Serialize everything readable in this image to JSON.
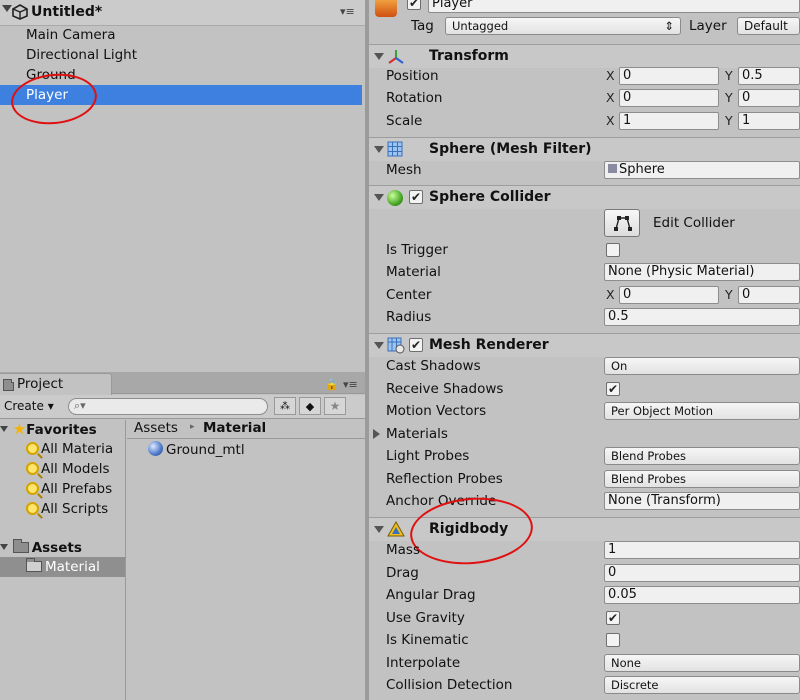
{
  "hierarchy": {
    "scene_title": "Untitled*",
    "items": [
      {
        "label": "Main Camera"
      },
      {
        "label": "Directional Light"
      },
      {
        "label": "Ground"
      },
      {
        "label": "Player"
      }
    ]
  },
  "project": {
    "tab_label": "Project",
    "create_label": "Create",
    "search_placeholder": "",
    "favorites_label": "Favorites",
    "favorites": [
      "All Materia",
      "All Models",
      "All Prefabs",
      "All Scripts"
    ],
    "assets_label": "Assets",
    "assets_children": [
      "Material"
    ],
    "breadcrumb": {
      "root": "Assets",
      "current": "Material"
    },
    "files": [
      {
        "name": "Ground_mtl"
      }
    ]
  },
  "inspector": {
    "object_name": "Player",
    "tag_label": "Tag",
    "tag_value": "Untagged",
    "layer_label": "Layer",
    "layer_value": "Default",
    "transform": {
      "title": "Transform",
      "position_label": "Position",
      "position": {
        "x": "0",
        "y": "0.5"
      },
      "rotation_label": "Rotation",
      "rotation": {
        "x": "0",
        "y": "0"
      },
      "scale_label": "Scale",
      "scale": {
        "x": "1",
        "y": "1"
      }
    },
    "mesh_filter": {
      "title": "Sphere (Mesh Filter)",
      "mesh_label": "Mesh",
      "mesh_value": "Sphere"
    },
    "sphere_collider": {
      "title": "Sphere Collider",
      "edit_collider_label": "Edit Collider",
      "is_trigger_label": "Is Trigger",
      "is_trigger": false,
      "material_label": "Material",
      "material_value": "None (Physic Material)",
      "center_label": "Center",
      "center": {
        "x": "0",
        "y": "0"
      },
      "radius_label": "Radius",
      "radius": "0.5"
    },
    "mesh_renderer": {
      "title": "Mesh Renderer",
      "cast_shadows_label": "Cast Shadows",
      "cast_shadows": "On",
      "receive_shadows_label": "Receive Shadows",
      "receive_shadows": true,
      "motion_vectors_label": "Motion Vectors",
      "motion_vectors": "Per Object Motion",
      "materials_label": "Materials",
      "light_probes_label": "Light Probes",
      "light_probes": "Blend Probes",
      "reflection_probes_label": "Reflection Probes",
      "reflection_probes": "Blend Probes",
      "anchor_override_label": "Anchor Override",
      "anchor_override": "None (Transform)"
    },
    "rigidbody": {
      "title": "Rigidbody",
      "mass_label": "Mass",
      "mass": "1",
      "drag_label": "Drag",
      "drag": "0",
      "angular_drag_label": "Angular Drag",
      "angular_drag": "0.05",
      "use_gravity_label": "Use Gravity",
      "use_gravity": true,
      "is_kinematic_label": "Is Kinematic",
      "is_kinematic": false,
      "interpolate_label": "Interpolate",
      "interpolate": "None",
      "collision_detection_label": "Collision Detection",
      "collision_detection": "Discrete"
    },
    "axis_x": "X",
    "axis_y": "Y"
  },
  "colors": {
    "selection": "#3d80df",
    "annotation": "#e01010",
    "panel": "#c2c2c2"
  }
}
